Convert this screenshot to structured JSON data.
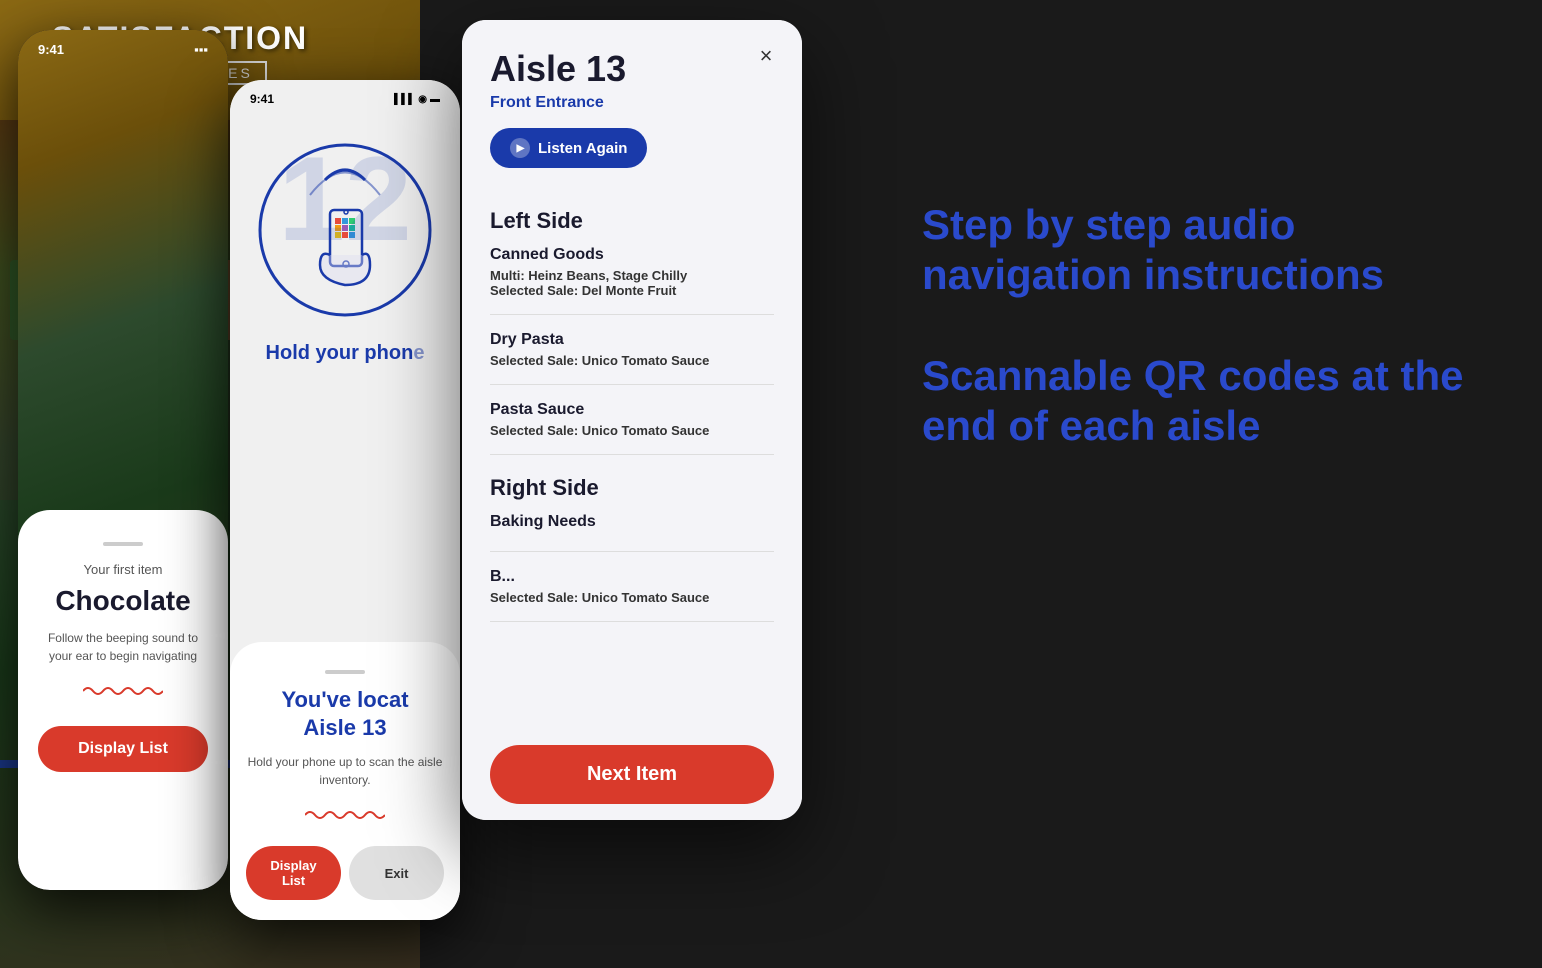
{
  "background": {
    "color": "#1a1a1a"
  },
  "phone1": {
    "status_time": "9:41",
    "overlay_subtitle": "Your first item",
    "overlay_title": "Chocolate",
    "overlay_desc": "Follow the beeping sound to your ear to begin navigating",
    "display_list_label": "Display List"
  },
  "phone2": {
    "status_time": "9:41",
    "hold_text": "Hold your phon...",
    "located_line1": "You've locat...",
    "located_line2": "Aisle 13",
    "hold_desc": "Hold your phone up to scan the aisle inventory.",
    "display_list_label": "Display List",
    "exit_label": "Exit"
  },
  "modal": {
    "close_label": "×",
    "aisle_title": "Aisle 13",
    "location": "Front Entrance",
    "listen_again": "Listen Again",
    "left_side_heading": "Left Side",
    "categories": [
      {
        "name": "Canned Goods",
        "multi_label": "Multi:",
        "multi_value": "Heinz Beans, Stage Chilly",
        "sale_label": "Selected Sale:",
        "sale_value": "Del Monte Fruit"
      },
      {
        "name": "Dry Pasta",
        "multi_label": null,
        "multi_value": null,
        "sale_label": "Selected Sale:",
        "sale_value": "Unico Tomato Sauce"
      },
      {
        "name": "Pasta Sauce",
        "multi_label": null,
        "multi_value": null,
        "sale_label": "Selected Sale:",
        "sale_value": "Unico Tomato Sauce"
      }
    ],
    "right_side_heading": "Right Side",
    "right_categories": [
      {
        "name": "Baking Needs",
        "multi_label": null,
        "multi_value": null,
        "sale_label": "Selected Sale:",
        "sale_value": "Unico Tomato Sauce"
      }
    ],
    "next_item_label": "Next Item"
  },
  "right_text": {
    "feature1": "Step by step audio navigation instructions",
    "feature2": "Scannable QR codes at the end of each aisle"
  }
}
